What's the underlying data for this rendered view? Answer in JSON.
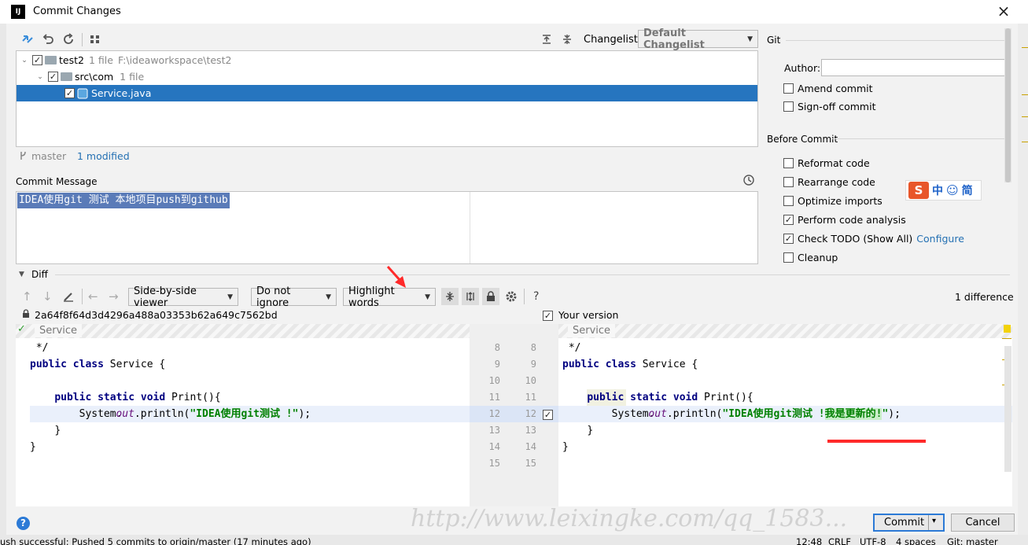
{
  "window": {
    "title": "Commit Changes",
    "app_icon_text": "IJ"
  },
  "toolbar": {
    "changelist_label": "Changelist:",
    "changelist_value": "Default Changelist"
  },
  "tree": {
    "root": {
      "name": "test2",
      "count": "1 file",
      "path": "F:\\ideaworkspace\\test2"
    },
    "folder": {
      "name": "src\\com",
      "count": "1 file"
    },
    "file": {
      "name": "Service.java"
    }
  },
  "status": {
    "branch": "master",
    "modified": "1 modified"
  },
  "commit_message": {
    "label": "Commit Message",
    "text": "IDEA使用git 测试 本地项目push到github"
  },
  "git_panel": {
    "header": "Git",
    "author_label": "Author:",
    "author_value": "",
    "amend": "Amend commit",
    "signoff": "Sign-off commit"
  },
  "before_commit": {
    "header": "Before Commit",
    "options": [
      {
        "label": "Reformat code",
        "checked": false
      },
      {
        "label": "Rearrange code",
        "checked": false
      },
      {
        "label": "Optimize imports",
        "checked": false
      },
      {
        "label": "Perform code analysis",
        "checked": true
      },
      {
        "label": "Check TODO (Show All)",
        "checked": true
      },
      {
        "label": "Cleanup",
        "checked": false
      }
    ],
    "configure_link": "Configure"
  },
  "ime": {
    "zh": "中",
    "mode": "简"
  },
  "diff": {
    "header": "Diff",
    "viewer": "Side-by-side viewer",
    "ignore": "Do not ignore",
    "highlight": "Highlight words",
    "help": "?",
    "difference_count": "1 difference",
    "left_revision": "2a64f8f64d3d4296a488a03353b62a649c7562bd",
    "right_revision": "Your version",
    "left_breadcrumb": "Service",
    "right_breadcrumb": "Service",
    "left_lines": [
      " */",
      "public class Service {",
      "",
      "    public static void Print(){",
      "        System.out.println(\"IDEA使用git测试 !\");",
      "    }",
      "}"
    ],
    "right_lines": [
      " */",
      "public class Service {",
      "",
      "    public static void Print(){",
      "        System.out.println(\"IDEA使用git测试 !我是更新的!\");",
      "    }",
      "}"
    ],
    "line_numbers": [
      "8",
      "9",
      "10",
      "11",
      "12",
      "13",
      "14",
      "15"
    ],
    "tokens": {
      "public": "public",
      "class": "class",
      "static": "static",
      "void": "void",
      "service_decl": " Service {",
      "print_decl": " Print(){",
      "system": "System.",
      "out": "out",
      "println_open": ".println(",
      "str_left": "\"IDEA使用git测试 !",
      "str_right_common": "\"IDEA使用git测试 !",
      "str_right_added": "我是更新的!",
      "str_close": "\"",
      "tail": ");",
      "brace_close": "}",
      "comment_end": " */"
    }
  },
  "buttons": {
    "commit": "Commit",
    "cancel": "Cancel"
  },
  "watermark": "http://www.leixingke.com/qq_1583...",
  "bottom_status": {
    "message": "ush successful: Pushed 5 commits to origin/master (17 minutes ago)",
    "position": "12:48",
    "line_sep": "CRLF",
    "encoding": "UTF-8",
    "indent": "4 spaces",
    "branch": "Git: master"
  },
  "colors": {
    "selection": "#2675bf",
    "changed_line": "#eaf0fb",
    "added_words": "#c9eec9",
    "link": "#2470b3",
    "annotation_red": "#ff2a2a"
  }
}
